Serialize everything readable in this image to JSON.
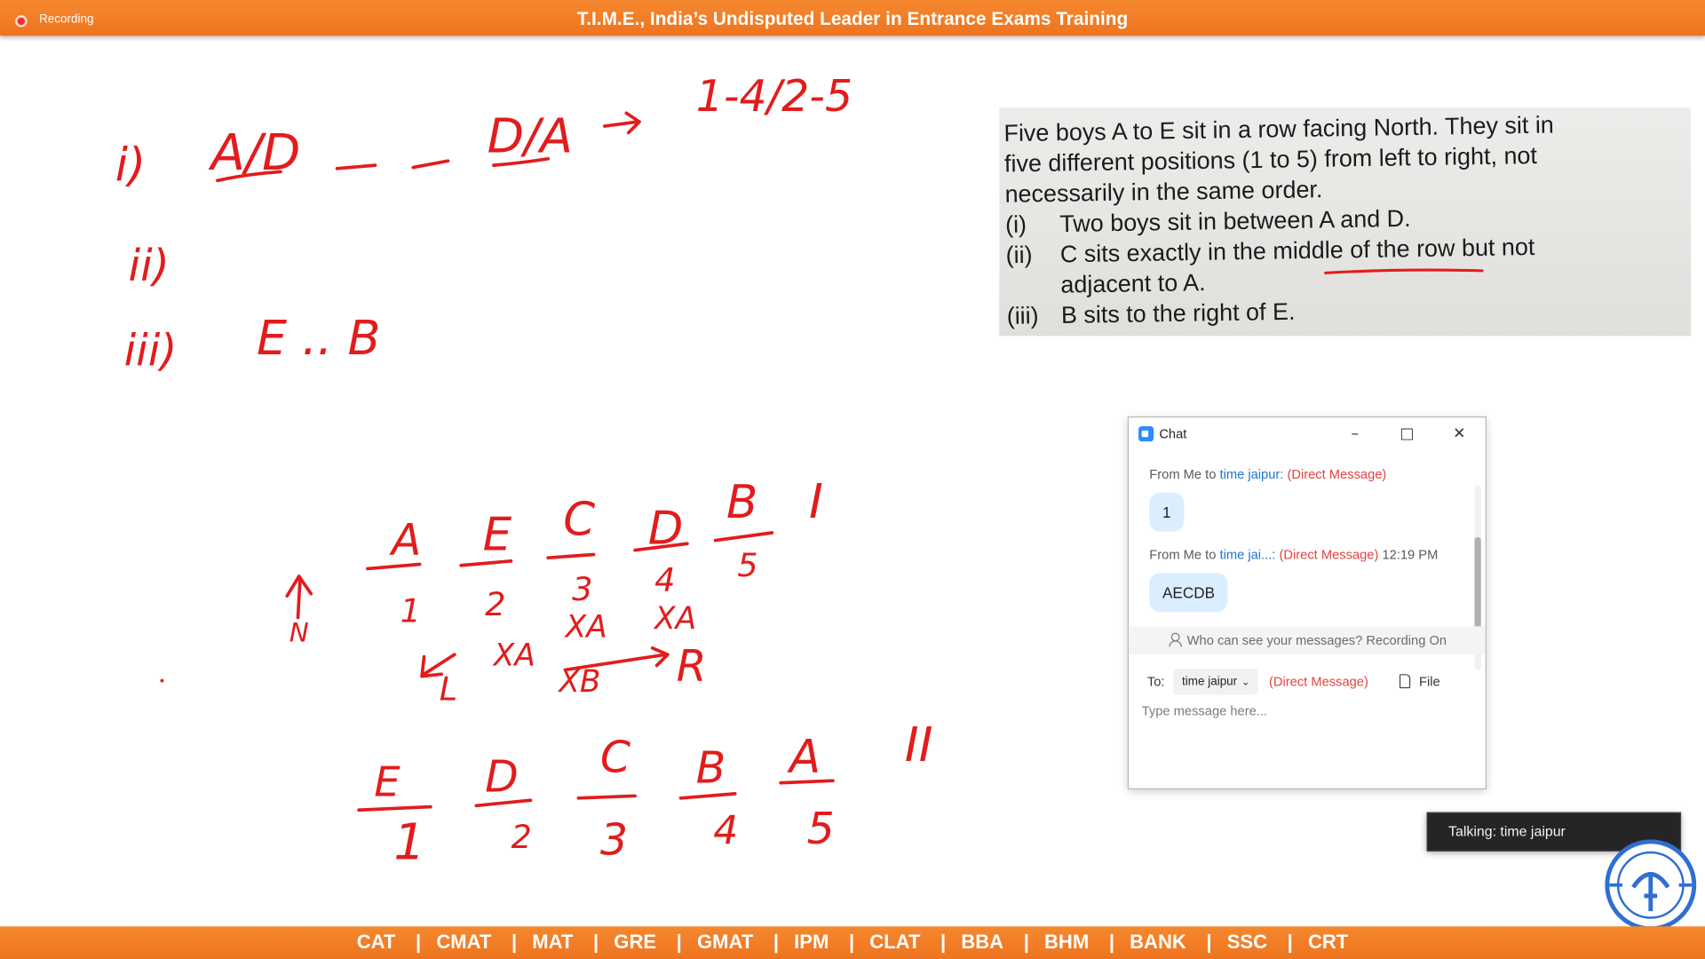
{
  "header": {
    "recording_label": "Recording",
    "title": "T.I.M.E., India’s Undisputed Leader in Entrance Exams Training"
  },
  "question": {
    "lines": [
      "Five boys A to E sit in a row facing North. They sit in",
      "five different positions (1 to 5) from left to right, not",
      "necessarily in the same order."
    ],
    "conditions": [
      {
        "num": "(i)",
        "text": "Two boys sit in between A and D."
      },
      {
        "num": "(ii)",
        "text": "C sits exactly in the middle of the row but not",
        "continuation": "adjacent to A."
      },
      {
        "num": "(iii)",
        "text": "B sits to the right of E."
      }
    ]
  },
  "whiteboard": {
    "clue_labels": [
      "i)",
      "ii)",
      "iii)"
    ],
    "clue1_left": "A/D",
    "clue1_right": "D/A",
    "clue1_cases": "1-4/2-5",
    "clue3": "E .. B",
    "case1": {
      "label": "I",
      "letters": [
        "A",
        "E",
        "C",
        "D",
        "B"
      ],
      "positions": [
        "1",
        "2",
        "3",
        "4",
        "5"
      ]
    },
    "case2": {
      "label": "II",
      "letters": [
        "E",
        "D",
        "C",
        "B",
        "A"
      ],
      "positions": [
        "1",
        "2",
        "3",
        "4",
        "5"
      ]
    },
    "north_label": "N",
    "left_label": "L",
    "right_label": "R",
    "cross_marks": [
      "XA",
      "XA",
      "XA",
      "XB"
    ]
  },
  "chat": {
    "title": "Chat",
    "messages": [
      {
        "prefix": "From Me to",
        "recipient": "time jaipur:",
        "tag": "(Direct Message)",
        "time": "",
        "body": "1"
      },
      {
        "prefix": "From Me to",
        "recipient": "time jai...:",
        "tag": "(Direct Message)",
        "time": "12:19 PM",
        "body": "AECDB"
      }
    ],
    "visibility_note": "Who can see your messages? Recording On",
    "to_label": "To:",
    "to_selected": "time jaipur",
    "to_tag": "(Direct Message)",
    "file_label": "File",
    "input_placeholder": "Type message here..."
  },
  "talking": "Talking: time jaipur",
  "footer": {
    "exams": [
      "CAT",
      "CMAT",
      "MAT",
      "GRE",
      "GMAT",
      "IPM",
      "CLAT",
      "BBA",
      "BHM",
      "BANK",
      "SSC",
      "CRT"
    ]
  },
  "colors": {
    "banner": "#f07a22",
    "ink": "#e21c1c",
    "chat_bubble": "#dbeeff",
    "link_blue": "#1f74d8",
    "dm_red": "#e4423f"
  }
}
